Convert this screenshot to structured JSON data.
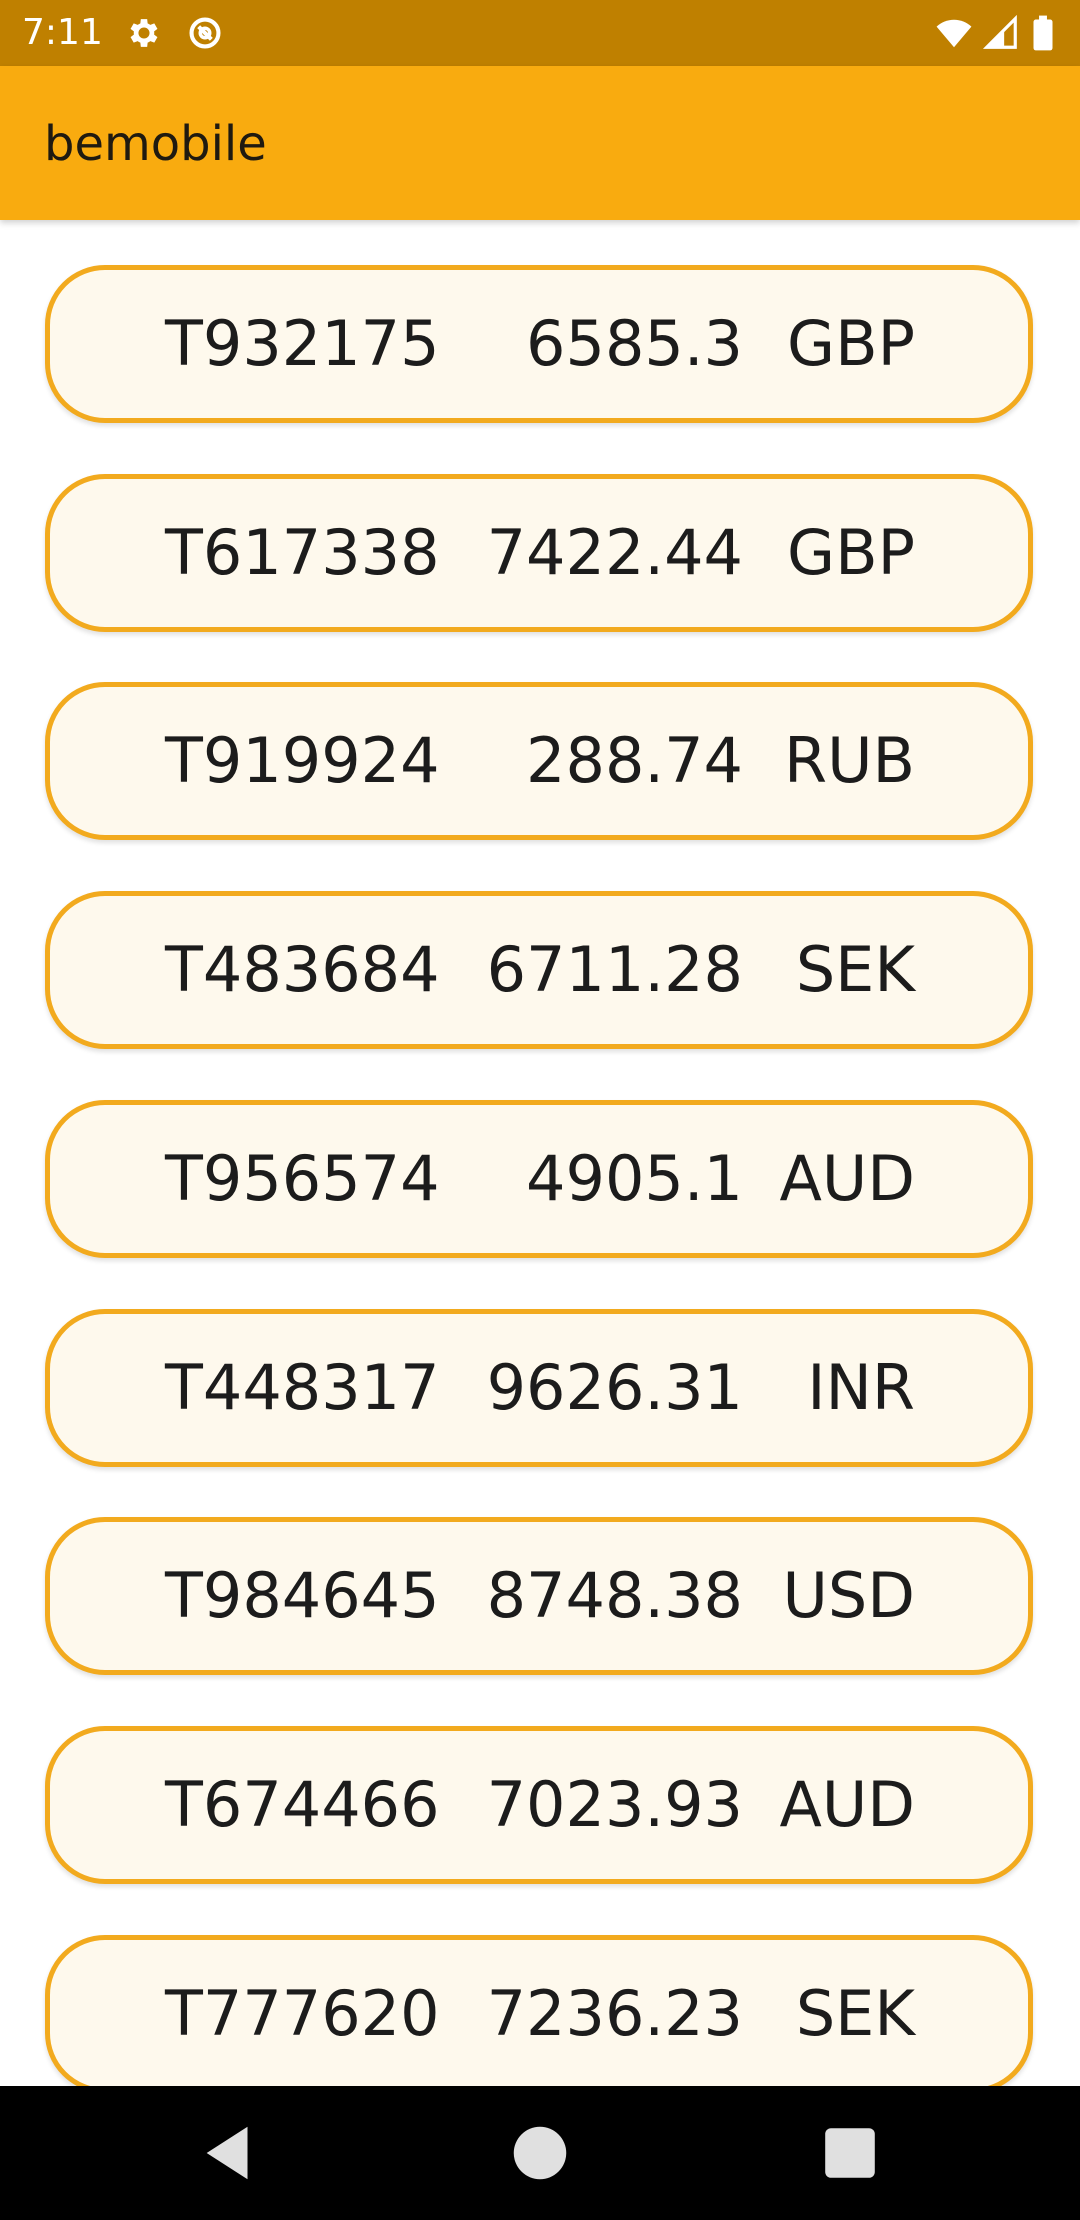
{
  "status_bar": {
    "time": "7:11",
    "icons": [
      "gear-icon",
      "sync-icon",
      "wifi-icon",
      "signal-icon",
      "battery-icon"
    ]
  },
  "app_bar": {
    "title": "bemobile",
    "color": "#f9ab0f"
  },
  "transactions": [
    {
      "id": "T932175",
      "amount": "6585.3",
      "currency": "GBP"
    },
    {
      "id": "T617338",
      "amount": "7422.44",
      "currency": "GBP"
    },
    {
      "id": "T919924",
      "amount": "288.74",
      "currency": "RUB"
    },
    {
      "id": "T483684",
      "amount": "6711.28",
      "currency": "SEK"
    },
    {
      "id": "T956574",
      "amount": "4905.1",
      "currency": "AUD"
    },
    {
      "id": "T448317",
      "amount": "9626.31",
      "currency": "INR"
    },
    {
      "id": "T984645",
      "amount": "8748.38",
      "currency": "USD"
    },
    {
      "id": "T674466",
      "amount": "7023.93",
      "currency": "AUD"
    },
    {
      "id": "T777620",
      "amount": "7236.23",
      "currency": "SEK"
    }
  ],
  "nav_bar": {
    "icons": [
      "back-icon",
      "home-icon",
      "recents-icon"
    ]
  },
  "colors": {
    "status_bar": "#bf8000",
    "card_border": "#f2aa1e",
    "card_background": "#fef9ed"
  }
}
